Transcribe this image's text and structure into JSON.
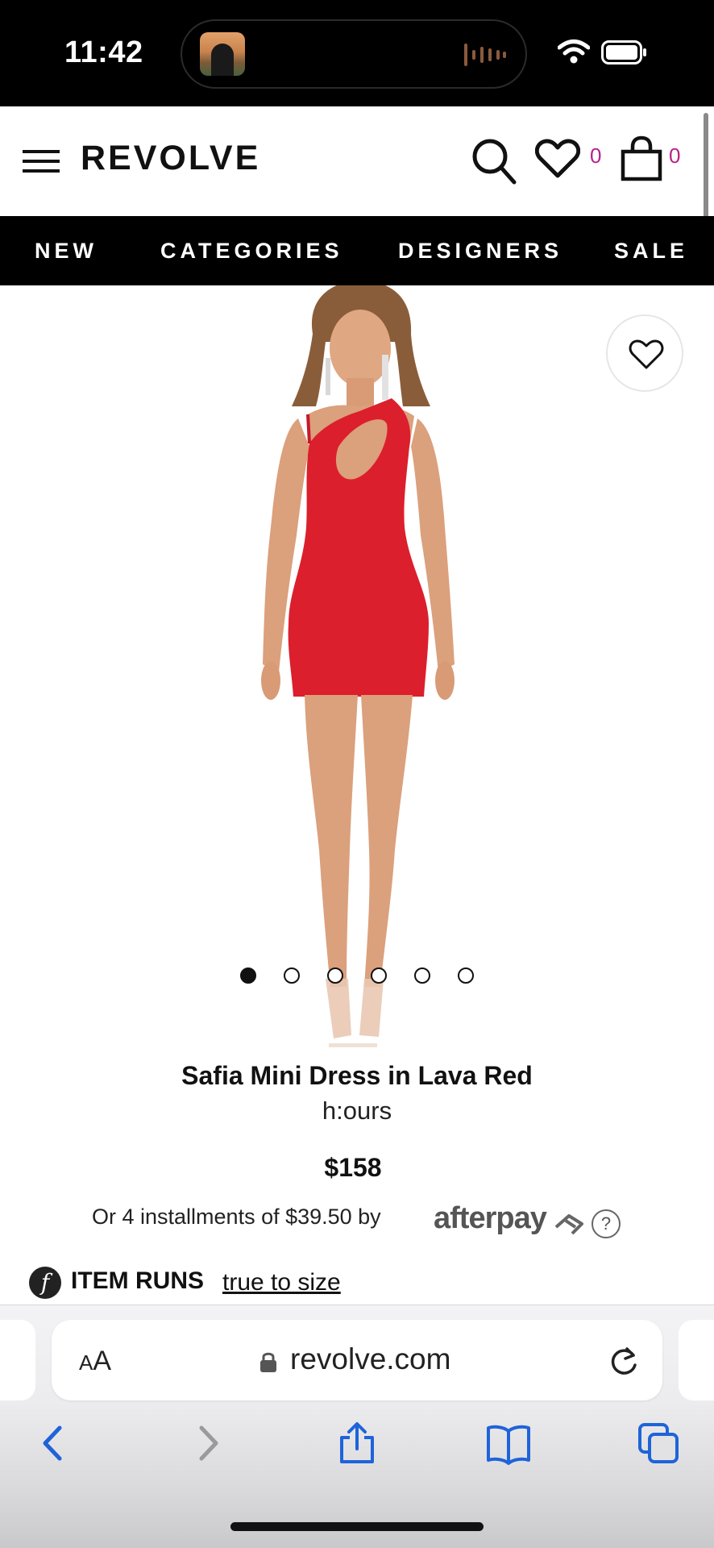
{
  "status_bar": {
    "time": "11:42"
  },
  "header": {
    "logo": "REVOLVE",
    "wishlist_count": "0",
    "bag_count": "0"
  },
  "nav": {
    "items": [
      "NEW",
      "CATEGORIES",
      "DESIGNERS",
      "SALE"
    ]
  },
  "gallery": {
    "image_count": 6,
    "active_index": 0
  },
  "product": {
    "title": "Safia Mini Dress in Lava Red",
    "brand": "h:ours",
    "price": "$158",
    "installments_text": "Or 4 installments of $39.50 by",
    "afterpay_label": "afterpay",
    "help_label": "?",
    "fit_icon": "f",
    "fit_label": "ITEM RUNS",
    "fit_value": "true to size"
  },
  "browser": {
    "text_size_small": "A",
    "text_size_large": "A",
    "domain": "revolve.com"
  },
  "colors": {
    "accent_count": "#b6238a",
    "dress": "#dc1f2c",
    "safari_blue": "#1f63d9"
  }
}
